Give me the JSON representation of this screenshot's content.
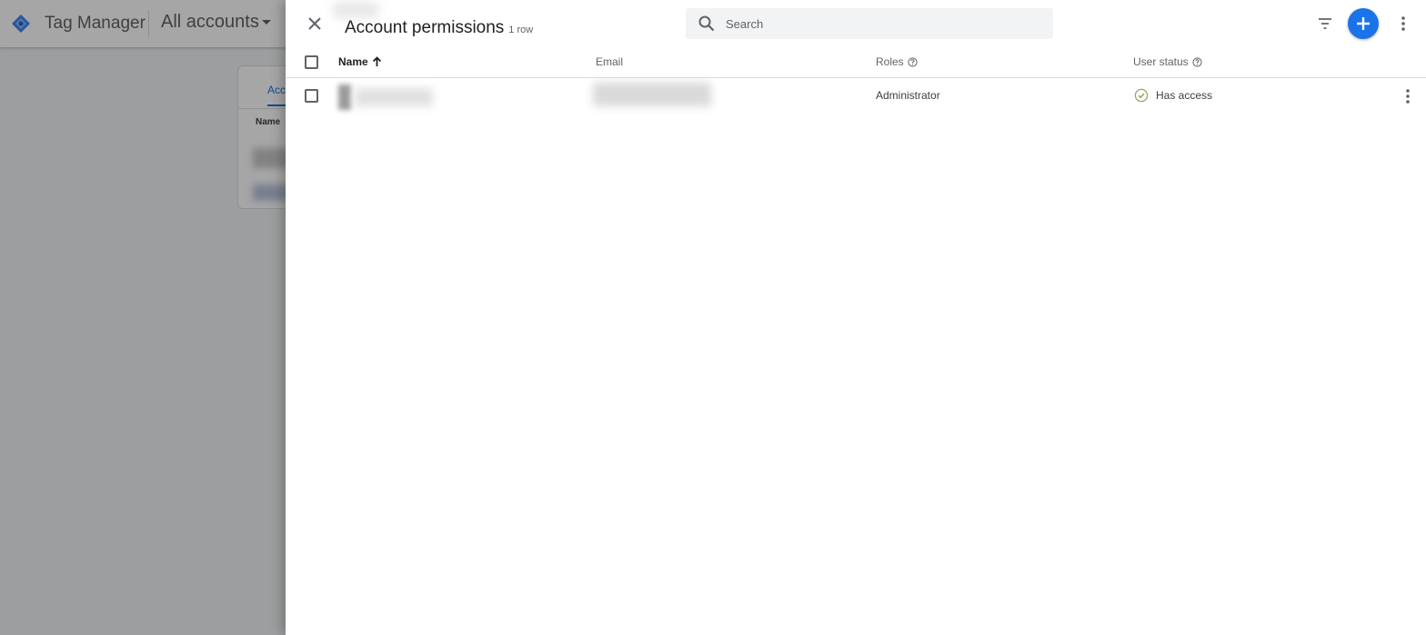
{
  "app": {
    "product_name": "Tag Manager",
    "account_selector": "All accounts",
    "bg_tab": "Acc",
    "bg_column": "Name"
  },
  "panel": {
    "title": "Account permissions",
    "row_count": "1 row",
    "search": {
      "placeholder": "Search",
      "value": ""
    },
    "columns": [
      {
        "label": "Name",
        "sorted": "ascending",
        "help": false
      },
      {
        "label": "Email",
        "help": false
      },
      {
        "label": "Roles",
        "help": true
      },
      {
        "label": "User status",
        "help": true
      }
    ],
    "rows": [
      {
        "name": "",
        "email": "",
        "role": "Administrator",
        "status": "Has access"
      }
    ]
  },
  "colors": {
    "accent": "#1a73e8",
    "status_ok": "#7cb342",
    "text_primary": "#202124",
    "text_secondary": "#5f6368"
  },
  "icons": [
    "close-icon",
    "search-icon",
    "filter-icon",
    "add-icon",
    "more-vert-icon",
    "arrow-up-icon",
    "help-icon",
    "check-circle-icon"
  ]
}
